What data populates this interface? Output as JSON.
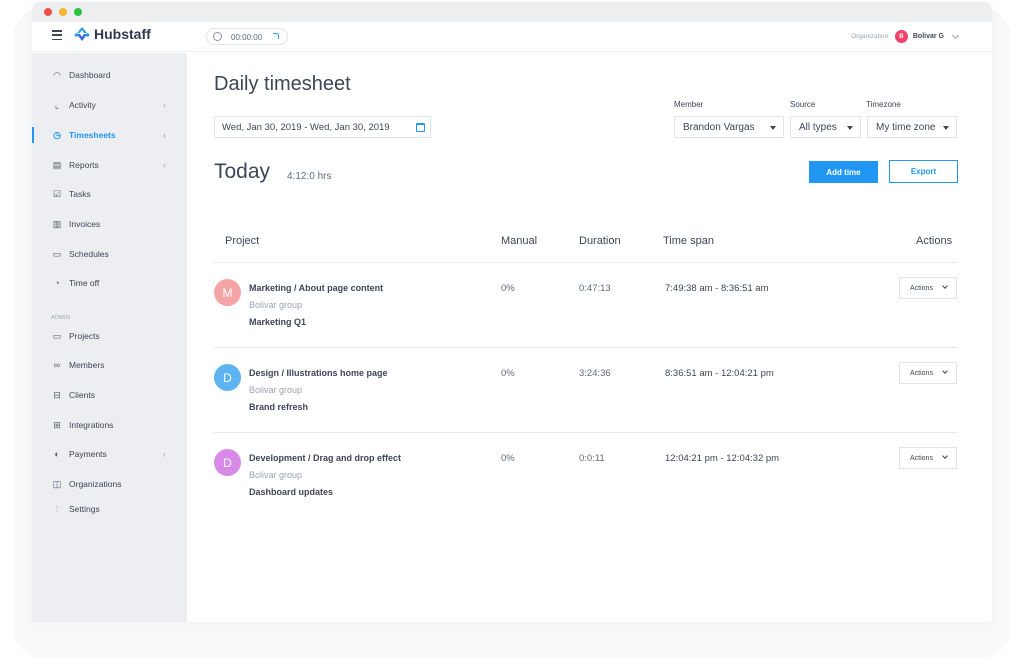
{
  "app": {
    "name": "Hubstaff",
    "timer": "00:00:00",
    "organization_label": "Organization:",
    "organization_avatar_letter": "B",
    "organization_name": "Bolivar G",
    "accent_color": "#2196f3"
  },
  "sidebar": {
    "items": [
      {
        "label": "Dashboard",
        "icon": "dashboard-icon",
        "has_caret": false
      },
      {
        "label": "Activity",
        "icon": "activity-chart-icon",
        "has_caret": true
      },
      {
        "label": "Timesheets",
        "icon": "clock-icon",
        "has_caret": true,
        "active": true
      },
      {
        "label": "Reports",
        "icon": "report-icon",
        "has_caret": true
      },
      {
        "label": "Tasks",
        "icon": "checkbox-icon",
        "has_caret": false
      },
      {
        "label": "Invoices",
        "icon": "invoice-icon",
        "has_caret": false
      },
      {
        "label": "Schedules",
        "icon": "calendar-icon",
        "has_caret": false
      },
      {
        "label": "Time off",
        "icon": "pie-icon",
        "has_caret": false
      }
    ],
    "admin_label": "ADMIN",
    "admin_items": [
      {
        "label": "Projects",
        "icon": "folder-icon",
        "has_caret": false
      },
      {
        "label": "Members",
        "icon": "members-icon",
        "has_caret": false
      },
      {
        "label": "Clients",
        "icon": "briefcase-icon",
        "has_caret": false
      },
      {
        "label": "Integrations",
        "icon": "integrations-icon",
        "has_caret": false
      },
      {
        "label": "Payments",
        "icon": "payments-icon",
        "has_caret": true
      },
      {
        "label": "Organizations",
        "icon": "organizations-icon",
        "has_caret": false
      },
      {
        "label": "Settings",
        "icon": "settings-sliders-icon",
        "has_caret": false
      }
    ],
    "caret_glyph": "‹"
  },
  "main": {
    "title": "Daily timesheet",
    "date_range": "Wed, Jan 30, 2019 - Wed, Jan 30, 2019",
    "filters": {
      "member_label": "Member",
      "member_value": "Brandon Vargas",
      "source_label": "Source",
      "source_value": "All types",
      "timezone_label": "Timezone",
      "timezone_value": "My time zone"
    },
    "today_label": "Today",
    "today_total": "4:12:0 hrs",
    "add_time_label": "Add time",
    "export_label": "Export",
    "table": {
      "headers": {
        "project": "Project",
        "manual": "Manual",
        "duration": "Duration",
        "time_span": "Time span",
        "actions": "Actions"
      },
      "rows": [
        {
          "avatar": "M",
          "avatar_color": "#f4a4a4",
          "project": "Marketing / About page content",
          "group": "Bolivar group",
          "task": "Marketing Q1",
          "manual": "0%",
          "duration": "0:47:13",
          "time_span": "7:49:38 am - 8:36:51 am",
          "actions_label": "Actions"
        },
        {
          "avatar": "D",
          "avatar_color": "#5db4f0",
          "project": "Design / Illustrations home page",
          "group": "Bolivar group",
          "task": "Brand refresh",
          "manual": "0%",
          "duration": "3:24:36",
          "time_span": "8:36:51 am - 12:04:21 pm",
          "actions_label": "Actions"
        },
        {
          "avatar": "D",
          "avatar_color": "#d98ae8",
          "project": "Development / Drag and drop effect",
          "group": "Bolivar group",
          "task": "Dashboard updates",
          "manual": "0%",
          "duration": "0:0:11",
          "time_span": "12:04:21 pm - 12:04:32 pm",
          "actions_label": "Actions"
        }
      ]
    }
  }
}
